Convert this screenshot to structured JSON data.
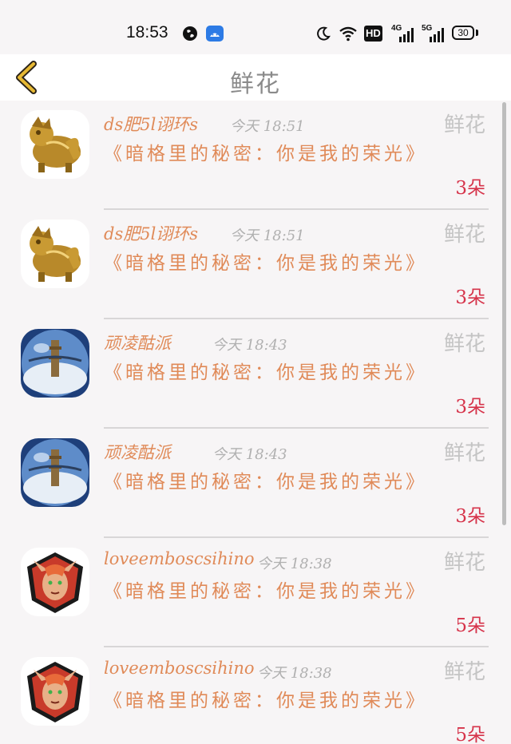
{
  "status_bar": {
    "time": "18:53",
    "icons": [
      "globe-icon",
      "app-icon",
      "moon-icon",
      "wifi-icon",
      "hd-icon",
      "signal-4g-icon",
      "signal-5g-icon",
      "battery-icon"
    ],
    "hd_label": "HD",
    "signal_1_label": "4G",
    "signal_2_label": "5G",
    "battery_level": "30"
  },
  "nav": {
    "back_icon": "chevron-left-icon",
    "title": "鲜花"
  },
  "items": [
    {
      "username": "ds肥5l诩环s",
      "time": "今天 18:51",
      "gift": "鲜花",
      "message": "《暗格里的秘密：你是我的荣光》",
      "count": "3朵",
      "avatar": "golden-dragon-avatar"
    },
    {
      "username": "ds肥5l诩环s",
      "time": "今天 18:51",
      "gift": "鲜花",
      "message": "《暗格里的秘密：你是我的荣光》",
      "count": "3朵",
      "avatar": "golden-dragon-avatar"
    },
    {
      "username": "顽凌酤派",
      "time": "今天 18:43",
      "gift": "鲜花",
      "message": "《暗格里的秘密：你是我的荣光》",
      "count": "3朵",
      "avatar": "crystal-ball-avatar"
    },
    {
      "username": "顽凌酤派",
      "time": "今天 18:43",
      "gift": "鲜花",
      "message": "《暗格里的秘密：你是我的荣光》",
      "count": "3朵",
      "avatar": "crystal-ball-avatar"
    },
    {
      "username": "loveemboscsihino",
      "time": "今天 18:38",
      "gift": "鲜花",
      "message": "《暗格里的秘密：你是我的荣光》",
      "count": "5朵",
      "avatar": "red-warrior-avatar"
    },
    {
      "username": "loveemboscsihino",
      "time": "今天 18:38",
      "gift": "鲜花",
      "message": "《暗格里的秘密：你是我的荣光》",
      "count": "5朵",
      "avatar": "red-warrior-avatar"
    }
  ],
  "colors": {
    "accent_orange": "#e08a58",
    "count_red": "#d6334a",
    "muted_gray": "#b0b0b0",
    "background": "#f7f5f6"
  }
}
